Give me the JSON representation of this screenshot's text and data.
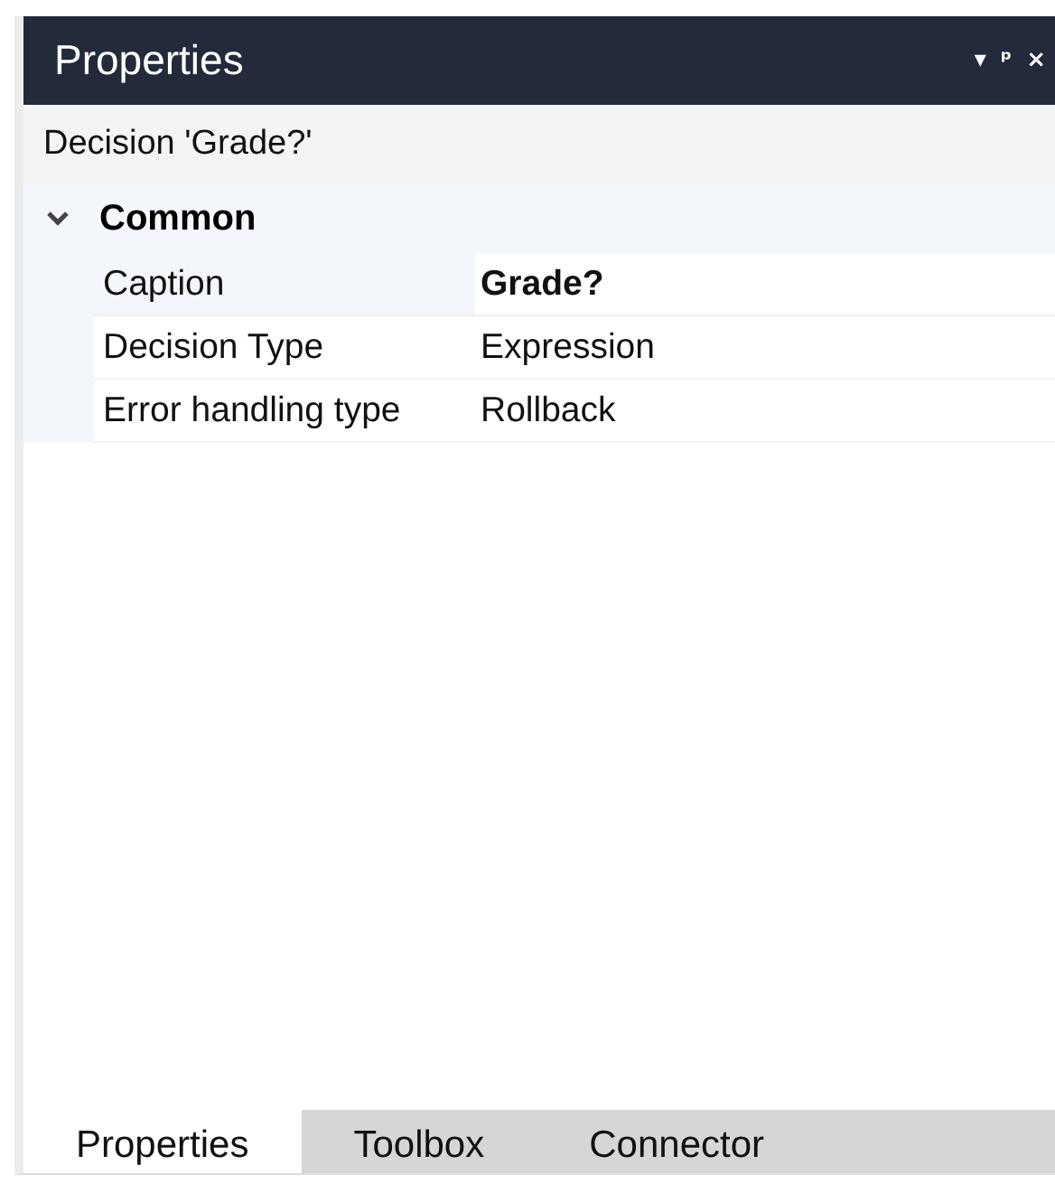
{
  "window": {
    "title": "Properties",
    "controls": [
      "▾",
      "ᵖ",
      "×"
    ]
  },
  "object_header": "Decision 'Grade?'",
  "groups": [
    {
      "name": "Common",
      "expanded": true,
      "rows": [
        {
          "label": "Caption",
          "value": "Grade?",
          "bold": true,
          "selected": true
        },
        {
          "label": "Decision Type",
          "value": "Expression",
          "bold": false,
          "selected": false
        },
        {
          "label": "Error handling type",
          "value": "Rollback",
          "bold": false,
          "selected": false
        }
      ]
    }
  ],
  "tabs": [
    {
      "label": "Properties",
      "selected": true
    },
    {
      "label": "Toolbox",
      "selected": false
    },
    {
      "label": "Connector",
      "selected": false
    }
  ]
}
